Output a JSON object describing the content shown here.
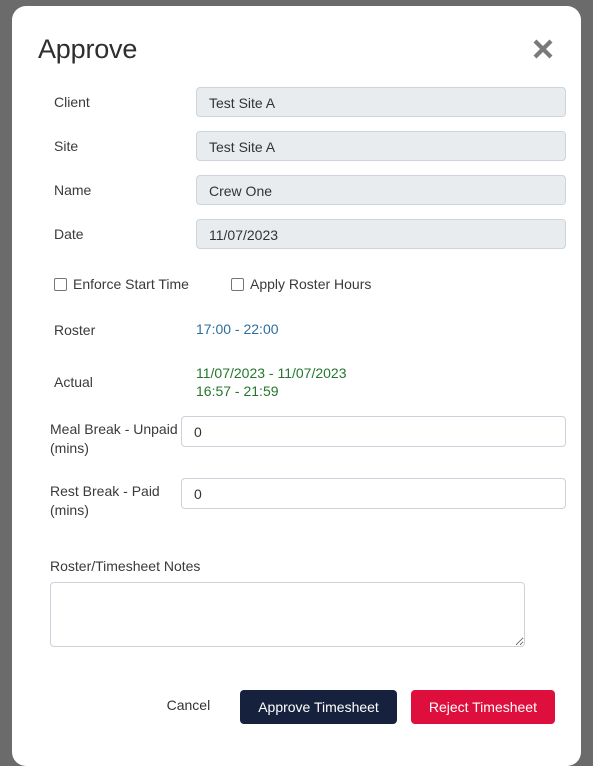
{
  "dialog": {
    "title": "Approve",
    "close_icon": "close-x-icon"
  },
  "readonly_fields": [
    {
      "label": "Client",
      "value": "Test Site A"
    },
    {
      "label": "Site",
      "value": "Test Site A"
    },
    {
      "label": "Name",
      "value": "Crew One"
    },
    {
      "label": "Date",
      "value": "11/07/2023"
    }
  ],
  "checkboxes": [
    {
      "label": "Enforce Start Time",
      "checked": false
    },
    {
      "label": "Apply Roster Hours",
      "checked": false
    }
  ],
  "roster": {
    "label": "Roster",
    "value": "17:00 - 22:00",
    "color": "#2c6e9e"
  },
  "actual": {
    "label": "Actual",
    "dates": "11/07/2023 - 11/07/2023",
    "times": "16:57 - 21:59",
    "color": "#24772c"
  },
  "breaks": [
    {
      "label": "Meal Break - Unpaid (mins)",
      "value": "0",
      "placeholder": ""
    },
    {
      "label": "Rest Break - Paid (mins)",
      "value": "0",
      "placeholder": ""
    }
  ],
  "notes": {
    "label": "Roster/Timesheet Notes",
    "value": "",
    "placeholder": ""
  },
  "footer": {
    "cancel_label": "Cancel",
    "approve_label": "Approve Timesheet",
    "reject_label": "Reject Timesheet",
    "approve_color": "#16213e",
    "reject_color": "#de0f3c"
  }
}
